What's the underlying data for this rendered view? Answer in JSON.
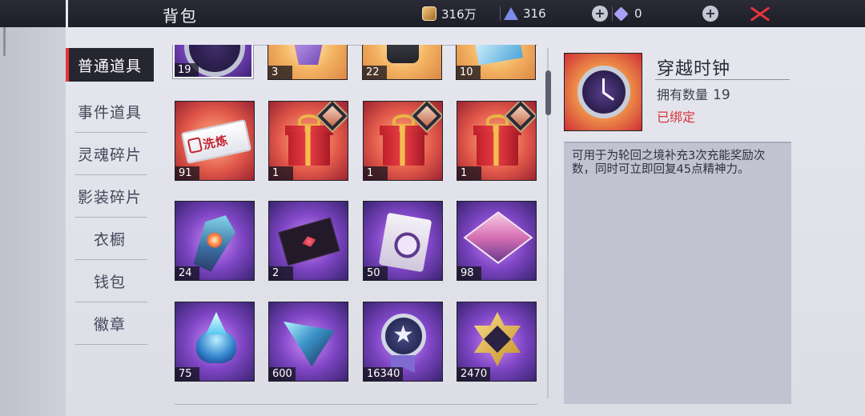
{
  "header": {
    "title": "背包",
    "gold": "316万",
    "crystal": "316",
    "diamond": "0"
  },
  "sidebar": {
    "items": [
      {
        "label": "普通道具",
        "active": true
      },
      {
        "label": "事件道具"
      },
      {
        "label": "灵魂碎片"
      },
      {
        "label": "影装碎片"
      },
      {
        "label": "衣橱"
      },
      {
        "label": "钱包"
      },
      {
        "label": "徽章"
      }
    ]
  },
  "grid": {
    "items": [
      {
        "name": "clock-item",
        "count": "19",
        "selected": true
      },
      {
        "name": "purple-gem-item",
        "count": "3"
      },
      {
        "name": "watch-item",
        "count": "22"
      },
      {
        "name": "ice-crystal-item",
        "count": "10"
      },
      {
        "name": "wash-ticket-item",
        "count": "91",
        "text": "洗炼"
      },
      {
        "name": "gift-box-item",
        "count": "1"
      },
      {
        "name": "gift-box-item",
        "count": "1"
      },
      {
        "name": "gift-box-item",
        "count": "1"
      },
      {
        "name": "crystal-shard-item",
        "count": "24"
      },
      {
        "name": "dark-envelope-item",
        "count": "2"
      },
      {
        "name": "eye-card-item",
        "count": "50"
      },
      {
        "name": "pink-cube-item",
        "count": "98"
      },
      {
        "name": "blue-core-item",
        "count": "75"
      },
      {
        "name": "prism-item",
        "count": "600"
      },
      {
        "name": "star-medal-item",
        "count": "16340"
      },
      {
        "name": "gold-hexagram-item",
        "count": "2470"
      }
    ]
  },
  "detail": {
    "name": "穿越时钟",
    "quantity_label": "拥有数量",
    "quantity": "19",
    "status": "已绑定",
    "description": "可用于为轮回之境补充3次充能奖励次数，同时可立即回复45点精神力。"
  },
  "colors": {
    "accent": "#e9333c",
    "topbar": "#1d1e27"
  }
}
